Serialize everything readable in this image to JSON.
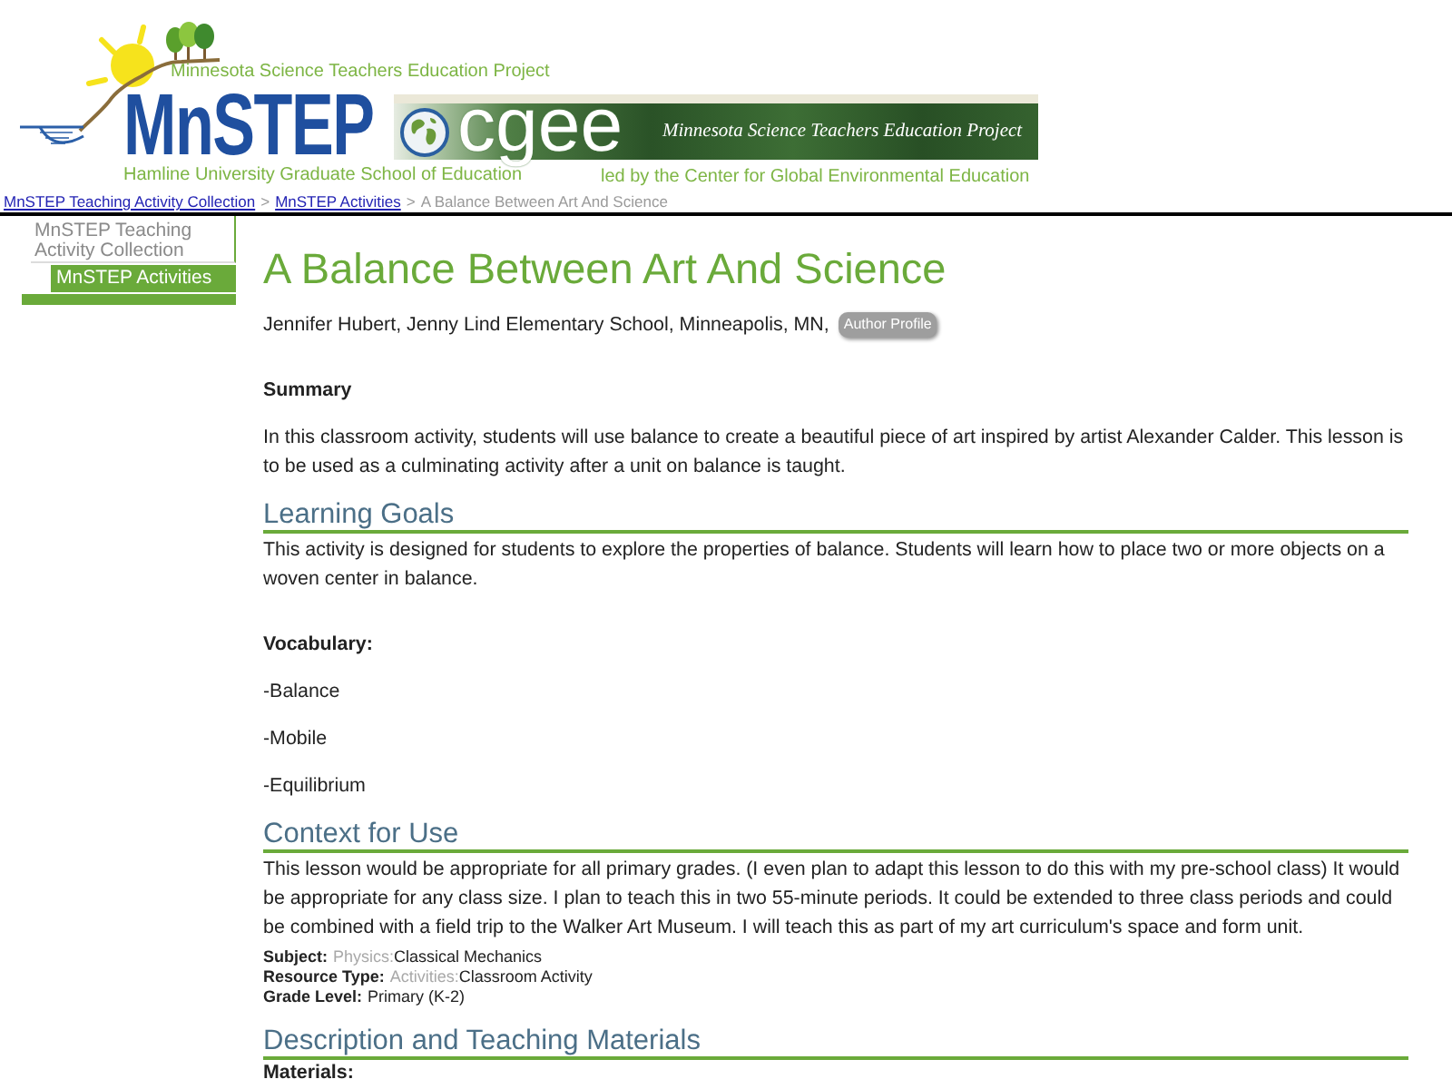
{
  "header": {
    "logo": {
      "tagline": "Minnesota Science Teachers Education Project",
      "name": "MnSTEP",
      "subtitle": "Hamline University Graduate School of Education"
    },
    "banner": {
      "name": "cgee",
      "tagline": "Minnesota Science Teachers Education Project",
      "credit": "led by the Center for Global Environmental Education"
    }
  },
  "breadcrumb": [
    {
      "kind": "link",
      "label": "MnSTEP Teaching Activity Collection"
    },
    {
      "kind": "separator",
      "label": ">"
    },
    {
      "kind": "link",
      "label": "MnSTEP Activities"
    },
    {
      "kind": "separator",
      "label": ">"
    },
    {
      "kind": "current",
      "label": "A Balance Between Art And Science"
    }
  ],
  "sidebar": {
    "items": [
      {
        "label": "MnSTEP Teaching Activity Collection",
        "selected": false,
        "children": [
          {
            "label": "MnSTEP Activities",
            "selected": true
          }
        ]
      }
    ]
  },
  "article": {
    "title": "A Balance Between Art And Science",
    "author": "Jennifer Hubert, Jenny Lind Elementary School, Minneapolis, MN,",
    "author_badge": "Author Profile",
    "blocks": [
      {
        "kind": "label",
        "text": "Summary"
      },
      {
        "kind": "paragraph",
        "text": "In this classroom activity, students will use balance to create a beautiful piece of art inspired by artist Alexander Calder. This lesson is to be used as a culminating activity after a unit on balance is taught."
      },
      {
        "kind": "heading",
        "text": "Learning Goals"
      },
      {
        "kind": "paragraph",
        "text": "This activity is designed for students to explore the properties of balance. Students will learn how to place two or more objects on a woven center in balance."
      },
      {
        "kind": "label",
        "text": "Vocabulary:"
      },
      {
        "kind": "paragraph",
        "text": "-Balance"
      },
      {
        "kind": "paragraph",
        "text": "-Mobile"
      },
      {
        "kind": "paragraph",
        "text": "-Equilibrium"
      },
      {
        "kind": "heading",
        "text": "Context for Use"
      },
      {
        "kind": "paragraph",
        "text": "This lesson would be appropriate for all primary grades. (I even plan to adapt this lesson to do this with my pre-school class) It would be appropriate for any class size. I plan to teach this in two 55-minute periods. It could be extended to three class periods and could be combined with a field trip to the Walker Art Museum. I will teach this as part of my art curriculum's space and form unit."
      },
      {
        "kind": "meta",
        "items": [
          {
            "label": "Subject:",
            "category": "Physics:",
            "value": "Classical Mechanics"
          },
          {
            "label": "Resource Type:",
            "category": "Activities:",
            "value": "Classroom Activity"
          },
          {
            "label": "Grade Level:",
            "value": "Primary (K-2)"
          }
        ]
      },
      {
        "kind": "heading",
        "text": "Description and Teaching Materials"
      },
      {
        "kind": "label",
        "text": "Materials:"
      }
    ]
  }
}
